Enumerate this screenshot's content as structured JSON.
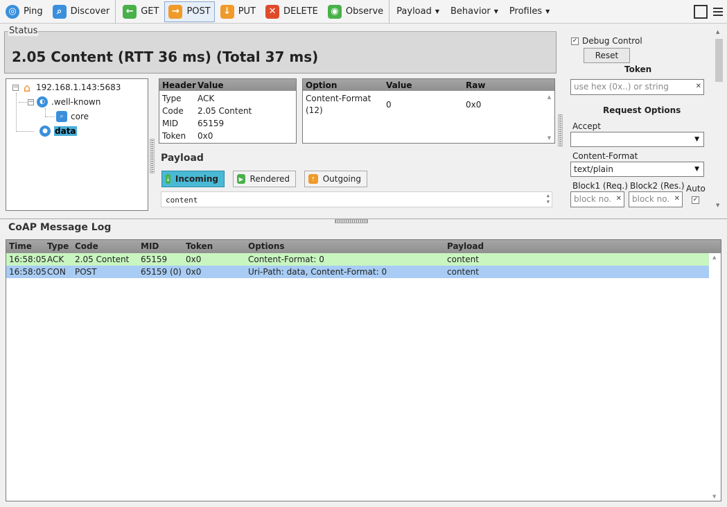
{
  "toolbar": {
    "buttons": [
      {
        "label": "Ping",
        "icon": "ping-icon",
        "color": "#3a8fdc"
      },
      {
        "label": "Discover",
        "icon": "discover-icon",
        "color": "#3a8fdc"
      },
      {
        "label": "GET",
        "icon": "get-icon",
        "color": "#49b04a"
      },
      {
        "label": "POST",
        "icon": "post-icon",
        "color": "#f09a2a"
      },
      {
        "label": "PUT",
        "icon": "put-icon",
        "color": "#f09a2a"
      },
      {
        "label": "DELETE",
        "icon": "delete-icon",
        "color": "#e04a2a"
      },
      {
        "label": "Observe",
        "icon": "observe-icon",
        "color": "#49b04a"
      }
    ],
    "menus": {
      "payload": "Payload",
      "behavior": "Behavior",
      "profiles": "Profiles"
    },
    "active": "POST"
  },
  "status": {
    "legend": "Status",
    "text": "2.05 Content (RTT 36 ms) (Total 37 ms)"
  },
  "tree": {
    "root": "192.168.1.143:5683",
    "wellknown": ".well-known",
    "core": "core",
    "data": "data"
  },
  "header_table": {
    "col_header": "Header",
    "col_value": "Value",
    "rows": [
      {
        "k": "Type",
        "v": "ACK"
      },
      {
        "k": "Code",
        "v": "2.05 Content"
      },
      {
        "k": "MID",
        "v": "65159"
      },
      {
        "k": "Token",
        "v": "0x0"
      }
    ]
  },
  "options_table": {
    "col_option": "Option",
    "col_value": "Value",
    "col_raw": "Raw",
    "rows": [
      {
        "option": "Content-Format",
        "option2": "(12)",
        "value": "0",
        "raw": "0x0"
      }
    ]
  },
  "payload": {
    "title": "Payload",
    "tabs": {
      "incoming": "Incoming",
      "rendered": "Rendered",
      "outgoing": "Outgoing"
    },
    "content": "content"
  },
  "right_panel": {
    "debug_control": "Debug Control",
    "reset": "Reset",
    "token_title": "Token",
    "token_placeholder": "use hex (0x..) or string",
    "request_options": "Request Options",
    "accept_label": "Accept",
    "accept_value": "",
    "content_format_label": "Content-Format",
    "content_format_value": "text/plain",
    "block1_label": "Block1 (Req.)",
    "block2_label": "Block2 (Res.)",
    "auto_label": "Auto",
    "block_placeholder": "block no."
  },
  "log": {
    "title": "CoAP Message Log",
    "columns": {
      "time": "Time",
      "type": "Type",
      "code": "Code",
      "mid": "MID",
      "token": "Token",
      "options": "Options",
      "payload": "Payload"
    },
    "rows": [
      {
        "time": "16:58:05",
        "type": "ACK",
        "code": "2.05 Content",
        "mid": "65159",
        "token": "0x0",
        "options": "Content-Format: 0",
        "payload": "content",
        "color": "#c8f5c0"
      },
      {
        "time": "16:58:05",
        "type": "CON",
        "code": "POST",
        "mid": "65159 (0)",
        "token": "0x0",
        "options": "Uri-Path: data, Content-Format: 0",
        "payload": "content",
        "color": "#a8ccf4"
      }
    ]
  }
}
